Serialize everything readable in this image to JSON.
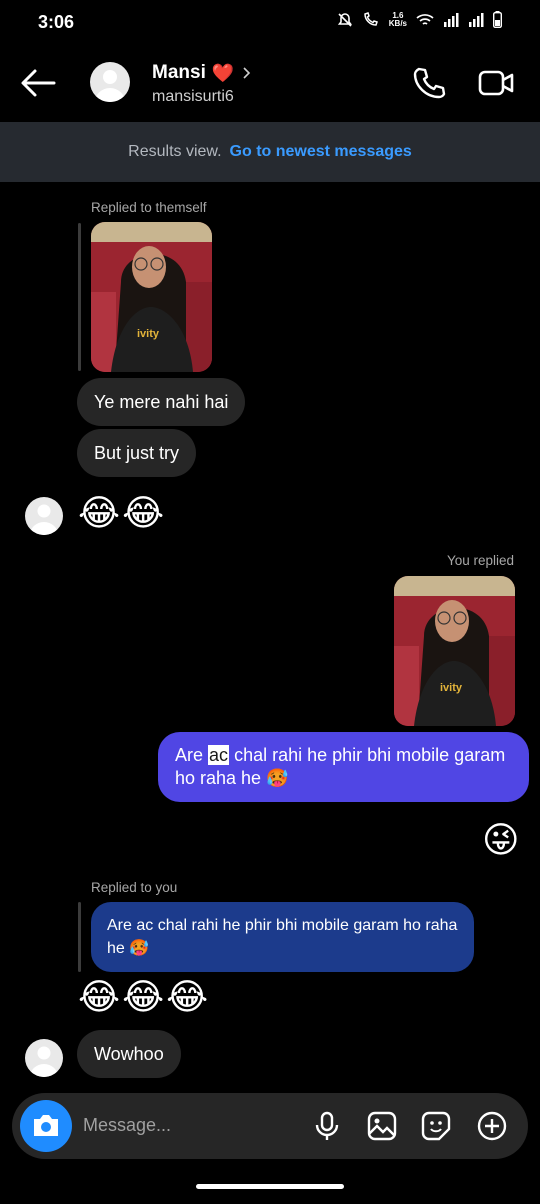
{
  "status_bar": {
    "time": "3:06",
    "net_speed_value": "1.6",
    "net_speed_unit": "KB/s"
  },
  "header": {
    "name": "Mansi",
    "name_emoji": "❤️",
    "username": "mansisurti6"
  },
  "banner": {
    "text": "Results view.",
    "link": "Go to newest messages"
  },
  "messages": {
    "reply_label_1": "Replied to themself",
    "bubble_1": "Ye mere nahi hai",
    "bubble_2": "But just try",
    "reaction_1": "😂😂",
    "reply_label_2": "You replied",
    "mine_pre": "Are",
    "mine_hl": "ac",
    "mine_post": "chal rahi he phir bhi mobile garam ho raha he 🥵",
    "emoji_wink": "😜",
    "reply_label_3": "Replied to you",
    "quoted": "Are ac chal rahi he phir bhi mobile garam ho raha he 🥵",
    "reaction_2": "😂😂😂",
    "bubble_3": "Wowhoo"
  },
  "composer": {
    "placeholder": "Message..."
  },
  "icons": [
    "back-arrow-icon",
    "phone-icon",
    "video-icon",
    "camera-icon",
    "microphone-icon",
    "gallery-icon",
    "sticker-icon",
    "plus-icon"
  ],
  "colors": {
    "accent": "#1f8cff",
    "my_bubble": "#5046e4",
    "quote_bubble": "#1c3b8c",
    "link": "#3a9bff"
  }
}
